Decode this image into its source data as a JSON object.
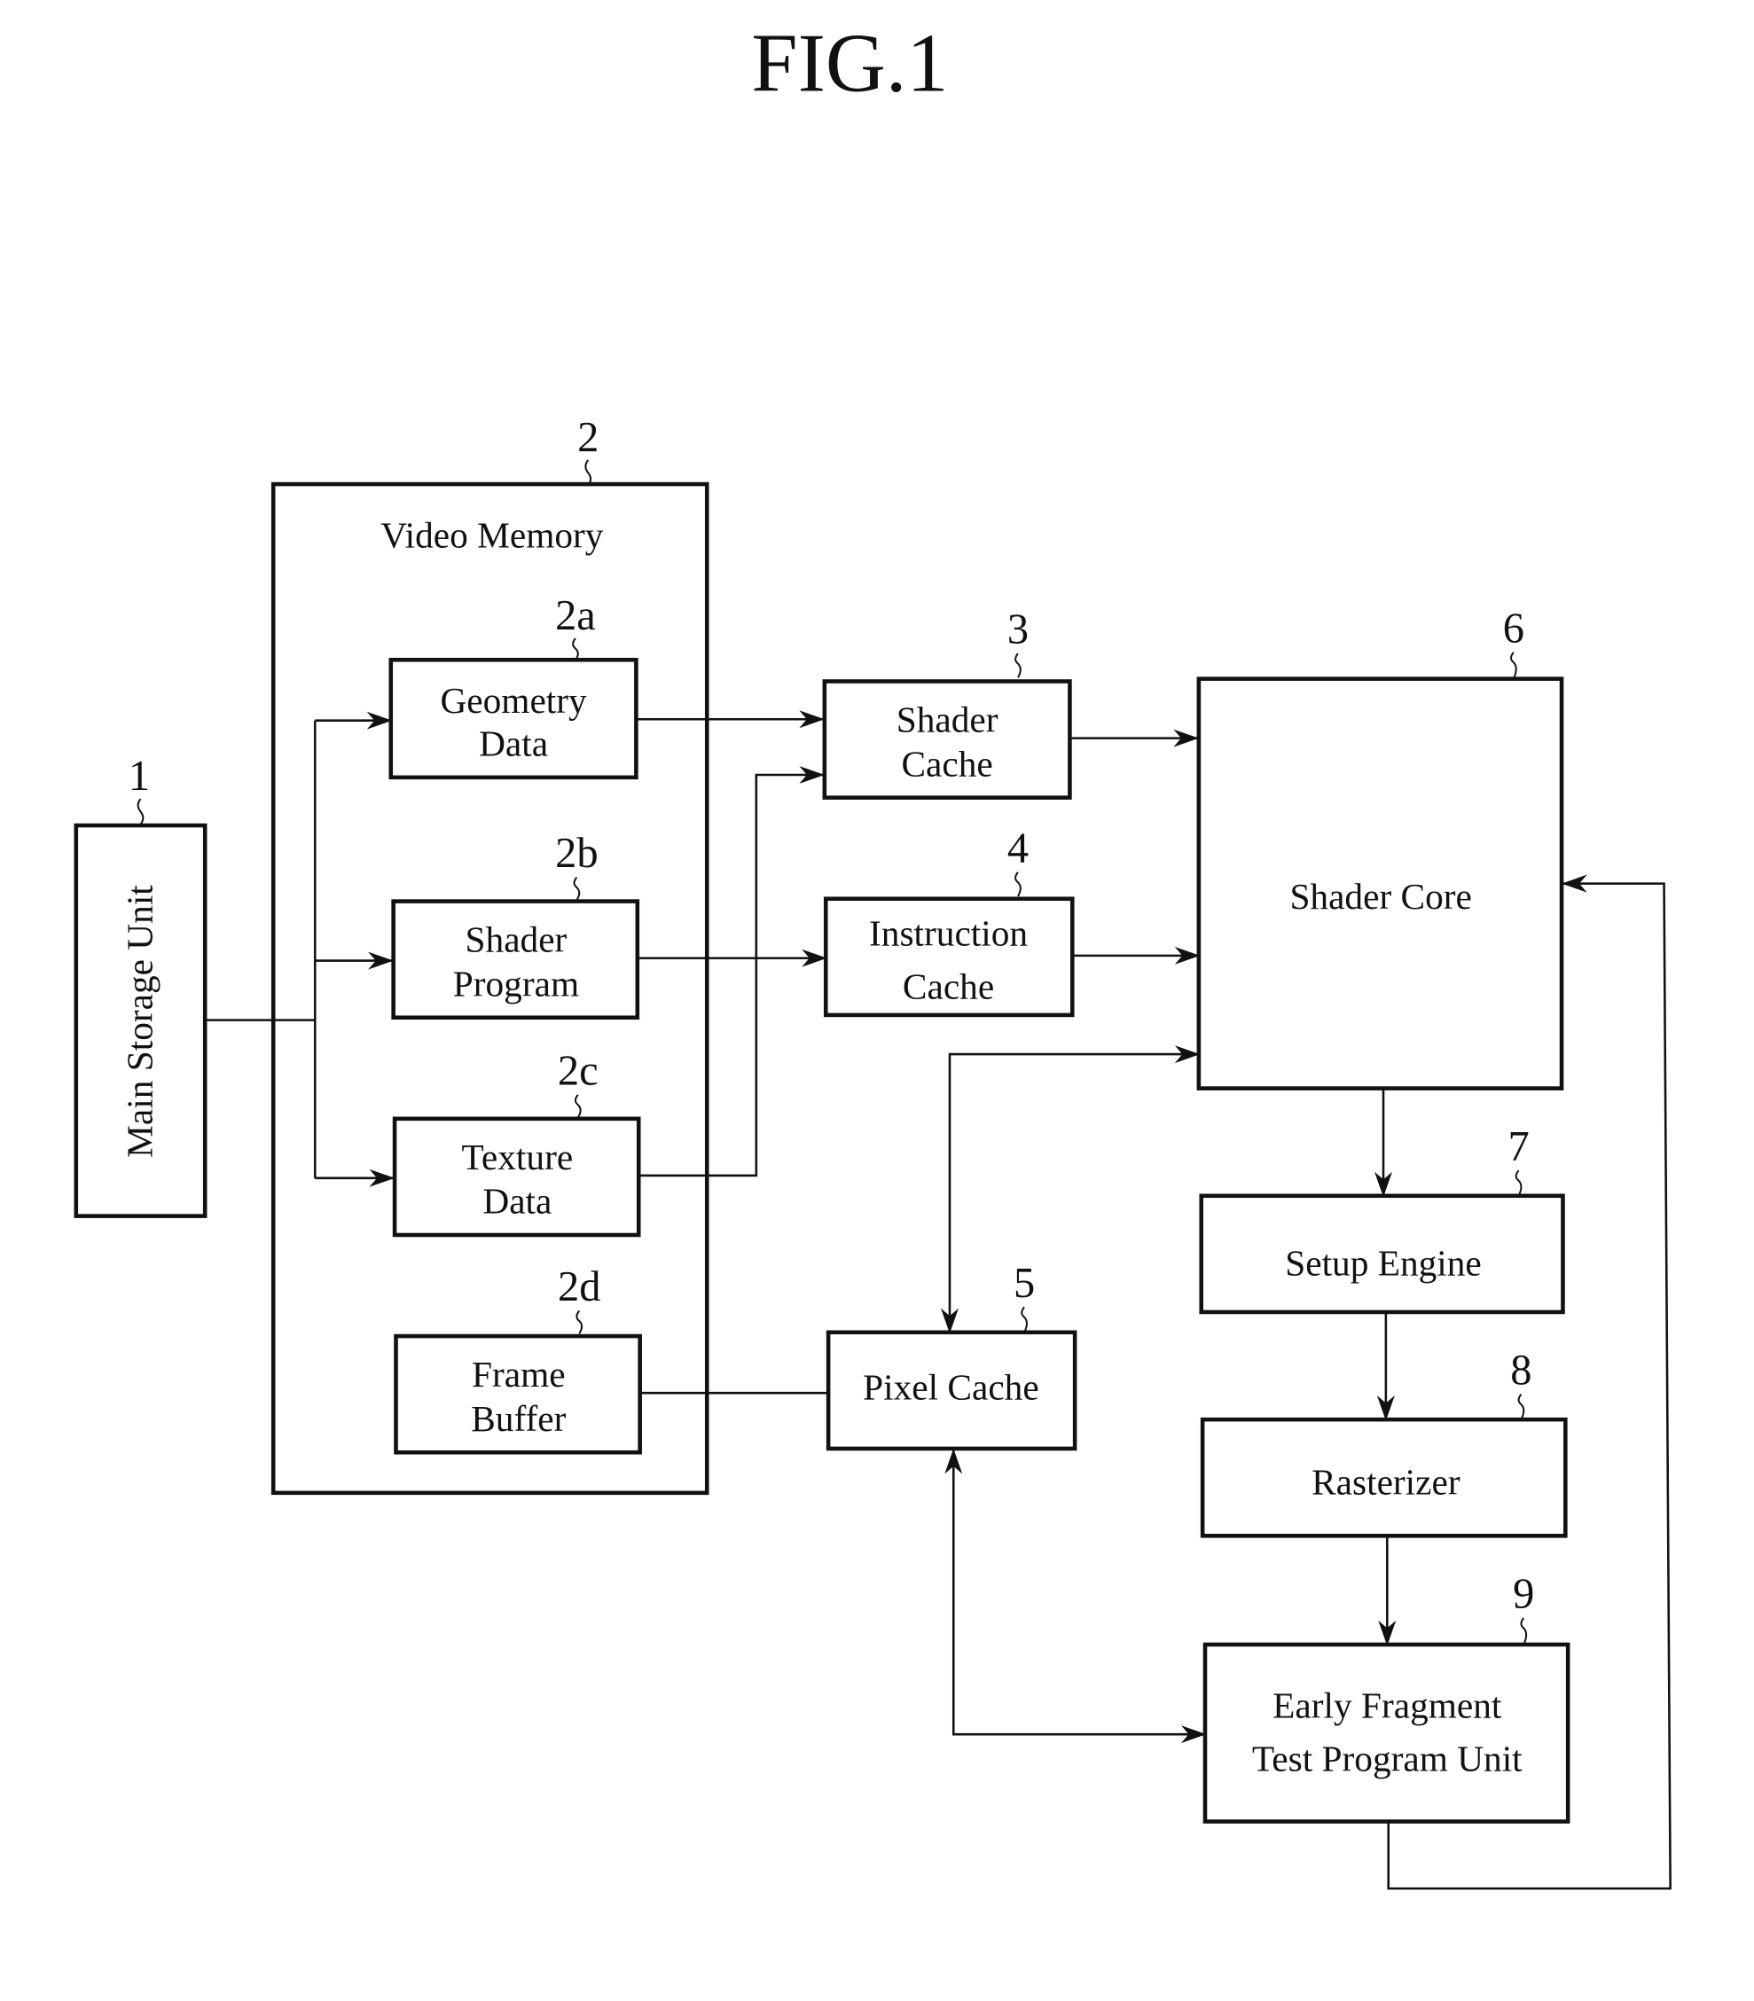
{
  "figure": {
    "title": "FIG.1"
  },
  "blocks": {
    "main_storage": {
      "ref": "1",
      "label": "Main Storage Unit"
    },
    "video_memory": {
      "ref": "2",
      "label": "Video Memory"
    },
    "geometry_data": {
      "ref": "2a",
      "line1": "Geometry",
      "line2": "Data"
    },
    "shader_program": {
      "ref": "2b",
      "line1": "Shader",
      "line2": "Program"
    },
    "texture_data": {
      "ref": "2c",
      "line1": "Texture",
      "line2": "Data"
    },
    "frame_buffer": {
      "ref": "2d",
      "line1": "Frame",
      "line2": "Buffer"
    },
    "shader_cache": {
      "ref": "3",
      "line1": "Shader",
      "line2": "Cache"
    },
    "instruction_cache": {
      "ref": "4",
      "line1": "Instruction",
      "line2": "Cache"
    },
    "pixel_cache": {
      "ref": "5",
      "label": "Pixel Cache"
    },
    "shader_core": {
      "ref": "6",
      "label": "Shader Core"
    },
    "setup_engine": {
      "ref": "7",
      "label": "Setup Engine"
    },
    "rasterizer": {
      "ref": "8",
      "label": "Rasterizer"
    },
    "early_fragment": {
      "ref": "9",
      "line1": "Early Fragment",
      "line2": "Test Program Unit"
    }
  },
  "connections": [
    {
      "from": "Main Storage Unit",
      "to": "Geometry Data"
    },
    {
      "from": "Main Storage Unit",
      "to": "Shader Program"
    },
    {
      "from": "Main Storage Unit",
      "to": "Texture Data"
    },
    {
      "from": "Geometry Data",
      "to": "Shader Cache"
    },
    {
      "from": "Texture Data",
      "to": "Shader Cache"
    },
    {
      "from": "Shader Program",
      "to": "Instruction Cache"
    },
    {
      "from": "Shader Cache",
      "to": "Shader Core"
    },
    {
      "from": "Instruction Cache",
      "to": "Shader Core"
    },
    {
      "from": "Pixel Cache",
      "to": "Shader Core",
      "bidirectional": true
    },
    {
      "from": "Frame Buffer",
      "to": "Pixel Cache"
    },
    {
      "from": "Shader Core",
      "to": "Setup Engine"
    },
    {
      "from": "Setup Engine",
      "to": "Rasterizer"
    },
    {
      "from": "Rasterizer",
      "to": "Early Fragment Test Program Unit"
    },
    {
      "from": "Pixel Cache",
      "to": "Early Fragment Test Program Unit",
      "bidirectional": true
    },
    {
      "from": "Early Fragment Test Program Unit",
      "to": "Shader Core"
    }
  ]
}
